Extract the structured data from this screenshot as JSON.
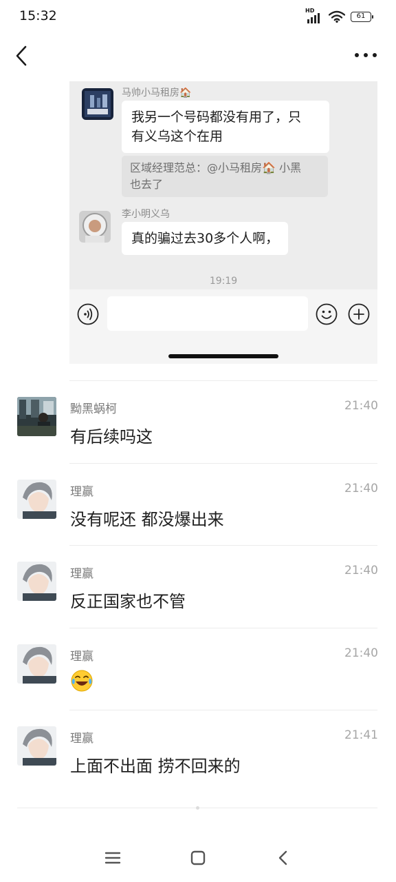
{
  "status_bar": {
    "time": "15:32",
    "network": "HD",
    "battery": "61"
  },
  "nav": {
    "back_icon": "back-arrow-icon",
    "more_icon": "more-dots-icon"
  },
  "screenshot": {
    "message1": {
      "sender": "马帅小马租房🏠",
      "text_line1": "我另一个号码都没有用了，只",
      "text_line2": "有义乌这个在用",
      "quote_line1": "区域经理范总：@小马租房🏠 小黑",
      "quote_line2": "也去了"
    },
    "message2": {
      "sender": "李小明义乌",
      "text": "真的骗过去30多个人啊，"
    },
    "time_separator": "19:19",
    "input_bar": {
      "voice_icon": "voice-icon",
      "emoji_icon": "emoji-icon",
      "plus_icon": "plus-icon"
    }
  },
  "comments": [
    {
      "name": "黝黑蜗柯",
      "time": "21:40",
      "text": "有后续吗这"
    },
    {
      "name": "理赢",
      "time": "21:40",
      "text": "没有呢还 都没爆出来"
    },
    {
      "name": "理赢",
      "time": "21:40",
      "text": "反正国家也不管"
    },
    {
      "name": "理赢",
      "time": "21:40",
      "text": "",
      "emoji": "laughing-tears-emoji"
    },
    {
      "name": "理赢",
      "time": "21:41",
      "text": "上面不出面 捞不回来的"
    }
  ],
  "system_nav": {
    "menu_icon": "menu-icon",
    "home_icon": "home-icon",
    "back_icon": "back-icon"
  },
  "colors": {
    "background": "#ffffff",
    "screenshot_bg": "#ededed",
    "secondary_text": "#7a7a7a",
    "time_text": "#a6a6a6"
  }
}
